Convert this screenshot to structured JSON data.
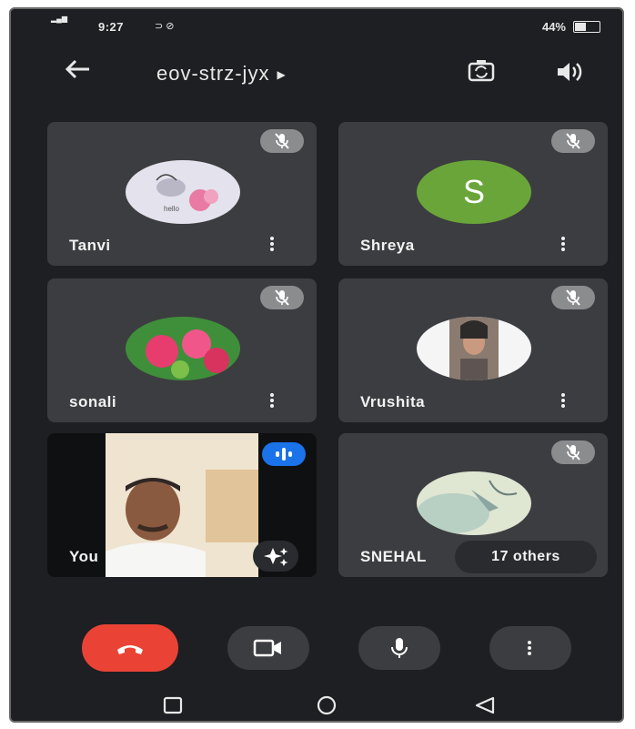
{
  "status_bar": {
    "time": "9:27",
    "battery": "44%"
  },
  "header": {
    "meeting_code": "eov-strz-jyx"
  },
  "participants": [
    {
      "name": "Tanvi"
    },
    {
      "name": "Shreya",
      "initial": "S"
    },
    {
      "name": "sonali"
    },
    {
      "name": "Vrushita"
    },
    {
      "name": "You"
    },
    {
      "name": "SNEHAL"
    }
  ],
  "others_count_label": "17 others",
  "colors": {
    "end_call": "#ea4335",
    "shreya_avatar": "#6aa53a",
    "active_speaker": "#1a73e8"
  },
  "icons": [
    "back-arrow-icon",
    "camera-switch-icon",
    "speaker-icon",
    "mic-off-icon",
    "more-vert-icon",
    "audio-activity-icon",
    "effects-icon",
    "call-end-icon",
    "videocam-icon",
    "mic-icon",
    "nav-recents-icon",
    "nav-home-icon",
    "nav-back-icon"
  ]
}
